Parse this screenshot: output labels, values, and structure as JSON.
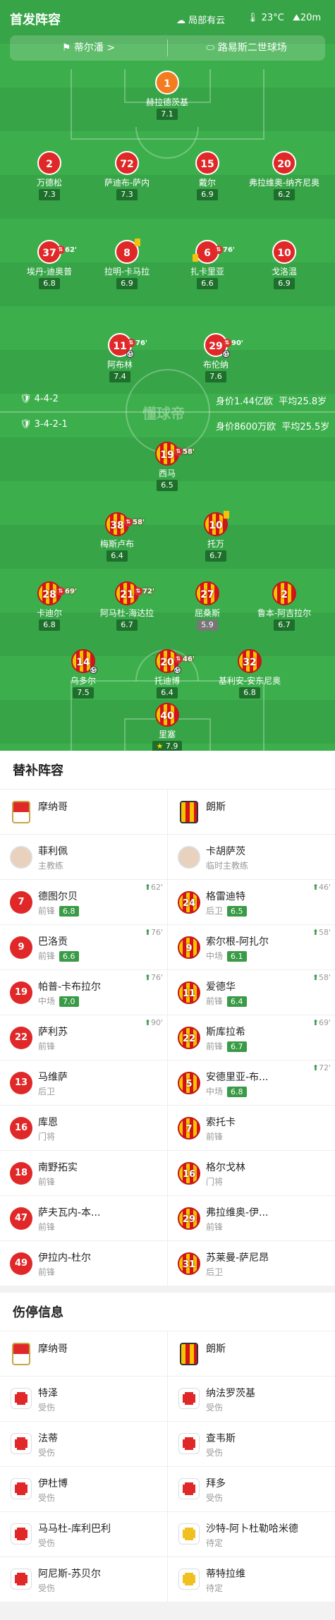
{
  "header": {
    "title": "首发阵容",
    "weather": "局部有云",
    "temp": "23°C",
    "wind": "20m",
    "home_btn": "蒂尔潘 >",
    "stadium": "路易斯二世球场"
  },
  "colors": {
    "home_shirt": "#e02828",
    "away_shirt": "#f5c400",
    "pitch": "#37a447"
  },
  "home_team": {
    "formation": "4-4-2",
    "value": "身价1.44亿欧",
    "age": "平均25.8岁"
  },
  "away_team": {
    "formation": "3-4-2-1",
    "value": "身价8600万欧",
    "age": "平均25.5岁"
  },
  "watermark": "懂球帝",
  "home_players": [
    {
      "no": "1",
      "name": "赫拉德茨基",
      "rating": "7.1",
      "kit": "gk",
      "sub": ""
    },
    {
      "no": "2",
      "name": "万德松",
      "rating": "7.3",
      "kit": "rd",
      "sub": ""
    },
    {
      "no": "72",
      "name": "萨迪布-萨内",
      "rating": "7.3",
      "kit": "rd",
      "sub": ""
    },
    {
      "no": "15",
      "name": "戴尔",
      "rating": "6.9",
      "kit": "rd",
      "sub": ""
    },
    {
      "no": "20",
      "name": "弗拉维奥-纳齐尼奥",
      "rating": "6.2",
      "kit": "rd",
      "sub": ""
    },
    {
      "no": "37",
      "name": "埃丹-迪奥普",
      "rating": "6.8",
      "kit": "rd",
      "sub": "62'"
    },
    {
      "no": "8",
      "name": "拉明-卡马拉",
      "rating": "6.9",
      "kit": "rd",
      "sub": ""
    },
    {
      "no": "6",
      "name": "扎卡里亚",
      "rating": "6.6",
      "kit": "rd",
      "sub": "76'"
    },
    {
      "no": "10",
      "name": "戈洛温",
      "rating": "6.9",
      "kit": "rd",
      "sub": ""
    },
    {
      "no": "11",
      "name": "阿布林",
      "rating": "7.4",
      "kit": "rd",
      "sub": "76'"
    },
    {
      "no": "29",
      "name": "布伦纳",
      "rating": "7.6",
      "kit": "rd",
      "sub": "90'"
    }
  ],
  "away_players": [
    {
      "no": "19",
      "name": "西马",
      "rating": "6.5",
      "sub": "58'"
    },
    {
      "no": "38",
      "name": "梅斯卢布",
      "rating": "6.4",
      "sub": "58'"
    },
    {
      "no": "10",
      "name": "托万",
      "rating": "6.7",
      "sub": ""
    },
    {
      "no": "28",
      "name": "卡迪尔",
      "rating": "6.8",
      "sub": "69'"
    },
    {
      "no": "21",
      "name": "阿马杜-海达拉",
      "rating": "6.7",
      "sub": "72'"
    },
    {
      "no": "27",
      "name": "屈桑斯",
      "rating": "5.9",
      "sub": ""
    },
    {
      "no": "2",
      "name": "鲁本-阿吉拉尔",
      "rating": "6.7",
      "sub": ""
    },
    {
      "no": "14",
      "name": "乌多尔",
      "rating": "7.5",
      "sub": ""
    },
    {
      "no": "20",
      "name": "托迪博",
      "rating": "6.4",
      "sub": "46'"
    },
    {
      "no": "32",
      "name": "基利安-安东尼奥",
      "rating": "6.8",
      "sub": ""
    },
    {
      "no": "40",
      "name": "里塞",
      "rating": "7.9",
      "sub": ""
    }
  ],
  "subs": {
    "title": "替补阵容",
    "home_team": "摩纳哥",
    "away_team": "朗斯",
    "home_coach": {
      "name": "菲利佩",
      "role": "主教练"
    },
    "away_coach": {
      "name": "卡胡萨茨",
      "role": "临时主教练"
    },
    "rows": [
      [
        {
          "no": "7",
          "name": "德图尔贝",
          "pos": "前锋",
          "rating": "6.8",
          "min": "62'"
        },
        {
          "no": "24",
          "name": "格雷迪特",
          "pos": "后卫",
          "rating": "6.5",
          "min": "46'"
        }
      ],
      [
        {
          "no": "9",
          "name": "巴洛贡",
          "pos": "前锋",
          "rating": "6.6",
          "min": "76'"
        },
        {
          "no": "9",
          "name": "索尔根-阿扎尔",
          "pos": "中场",
          "rating": "6.1",
          "min": "58'"
        }
      ],
      [
        {
          "no": "19",
          "name": "帕普-卡布拉尔",
          "pos": "中场",
          "rating": "7.0",
          "min": "76'"
        },
        {
          "no": "11",
          "name": "爱德华",
          "pos": "前锋",
          "rating": "6.4",
          "min": "58'"
        }
      ],
      [
        {
          "no": "22",
          "name": "萨利苏",
          "pos": "前锋",
          "rating": "",
          "min": "90'"
        },
        {
          "no": "22",
          "name": "斯库拉希",
          "pos": "前锋",
          "rating": "6.7",
          "min": "69'"
        }
      ],
      [
        {
          "no": "13",
          "name": "马维萨",
          "pos": "后卫",
          "rating": "",
          "min": ""
        },
        {
          "no": "5",
          "name": "安德里亚-布...",
          "pos": "中场",
          "rating": "6.8",
          "min": "72'"
        }
      ],
      [
        {
          "no": "16",
          "name": "库恩",
          "pos": "门将",
          "rating": "",
          "min": ""
        },
        {
          "no": "7",
          "name": "索托卡",
          "pos": "前锋",
          "rating": "",
          "min": ""
        }
      ],
      [
        {
          "no": "18",
          "name": "南野拓实",
          "pos": "前锋",
          "rating": "",
          "min": ""
        },
        {
          "no": "16",
          "name": "格尔戈林",
          "pos": "门将",
          "rating": "",
          "min": ""
        }
      ],
      [
        {
          "no": "47",
          "name": "萨夫瓦内-本...",
          "pos": "前锋",
          "rating": "",
          "min": ""
        },
        {
          "no": "29",
          "name": "弗拉维奥-伊...",
          "pos": "前锋",
          "rating": "",
          "min": ""
        }
      ],
      [
        {
          "no": "49",
          "name": "伊拉内-杜尔",
          "pos": "前锋",
          "rating": "",
          "min": ""
        },
        {
          "no": "31",
          "name": "苏莱曼-萨尼昂",
          "pos": "后卫",
          "rating": "",
          "min": ""
        }
      ]
    ]
  },
  "injuries": {
    "title": "伤停信息",
    "home_team": "摩纳哥",
    "away_team": "朗斯",
    "rows": [
      [
        {
          "name": "特泽",
          "status": "受伤",
          "kind": "r"
        },
        {
          "name": "纳法罗茨基",
          "status": "受伤",
          "kind": "r"
        }
      ],
      [
        {
          "name": "法蒂",
          "status": "受伤",
          "kind": "r"
        },
        {
          "name": "查韦斯",
          "status": "受伤",
          "kind": "r"
        }
      ],
      [
        {
          "name": "伊杜博",
          "status": "受伤",
          "kind": "r"
        },
        {
          "name": "拜多",
          "status": "受伤",
          "kind": "r"
        }
      ],
      [
        {
          "name": "马马杜-库利巴利",
          "status": "受伤",
          "kind": "r"
        },
        {
          "name": "沙特-阿卜杜勒哈米德",
          "status": "待定",
          "kind": "y"
        }
      ],
      [
        {
          "name": "阿尼斯-苏贝尔",
          "status": "受伤",
          "kind": "r"
        },
        {
          "name": "蒂特拉维",
          "status": "待定",
          "kind": "y"
        }
      ]
    ]
  }
}
